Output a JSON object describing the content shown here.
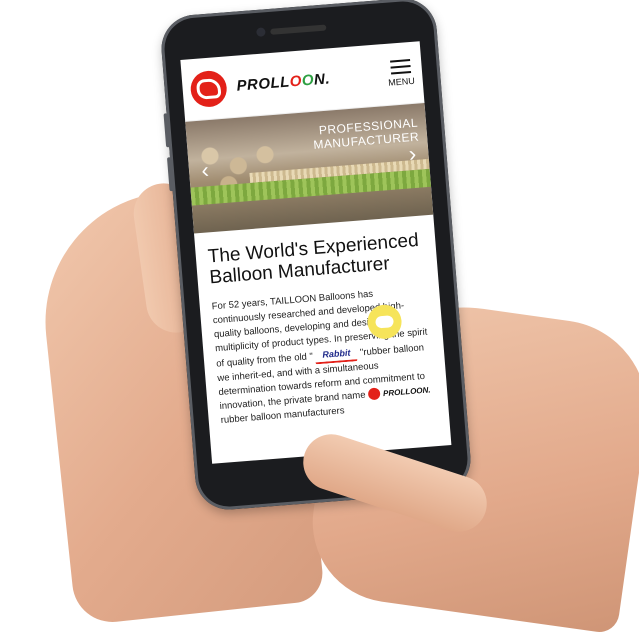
{
  "site": {
    "brand_prefix": "PROLL",
    "brand_o1": "O",
    "brand_o2": "O",
    "brand_suffix": "N.",
    "menu_label": "MENU",
    "hero": {
      "line1": "PROFESSIONAL",
      "line2": "MANUFACTURER"
    },
    "heading": "The World's Experienced Balloon Manufacturer",
    "para_part1": "For 52 years, TAILLOON Balloons has continuously researched and developed high-quality balloons, developing and designing a multiplicity of product types. In preserving the spirit of quality from the old \"",
    "rabbit_logo_text": "Rabbit",
    "para_part2": " \"rubber balloon we inherit-ed, and with a simultaneous determination towards reform and commitment to innovation, the private brand name ",
    "mini_brand": "PROLLOON.",
    "para_part3": " rubber balloon manufacturers"
  },
  "colors": {
    "brand_red": "#e32119",
    "brand_green": "#2ea043",
    "chat_yellow": "#f6e45a"
  },
  "icons": [
    "rabbit-logo-icon",
    "menu-icon",
    "chevron-left-icon",
    "chevron-right-icon",
    "chat-bubble-icon"
  ]
}
